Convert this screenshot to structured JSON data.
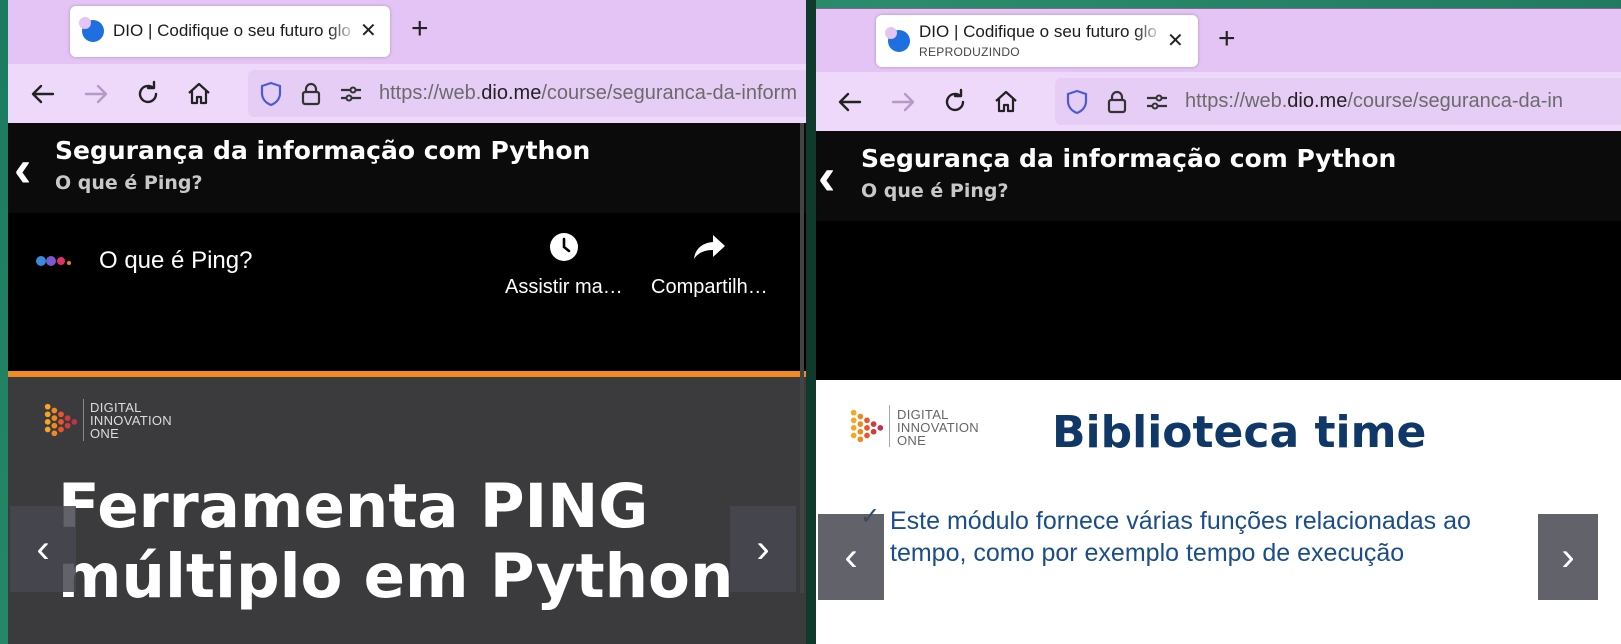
{
  "colors": {
    "tabbar": "#e3c4f5",
    "navbar": "#efd9fb",
    "accent_orange": "#f28a20",
    "slide_title_blue": "#0f3868",
    "slide_text_blue": "#1b4d8a",
    "dark_slide": "#3b3b3d"
  },
  "left_window": {
    "tab": {
      "title": "DIO | Codifique o seu futuro glo",
      "close": "✕"
    },
    "newtab": "+",
    "url": {
      "pre": "https://web.",
      "domain": "dio.me",
      "post": "/course/seguranca-da-inform"
    },
    "page": {
      "back": "‹",
      "title": "Segurança da informação com Python",
      "subtitle": "O que é Ping?"
    },
    "video": {
      "title": "O que é Ping?",
      "watch_later": "Assistir ma…",
      "share": "Compartilh…"
    },
    "slide": {
      "logo_line1": "DIGITAL",
      "logo_line2": "INNOVATION",
      "logo_line3": "ONE",
      "heading_line1": "Ferramenta PING",
      "heading_line2": "múltiplo em Python"
    },
    "prev": "‹",
    "next": "›"
  },
  "right_window": {
    "tab": {
      "title": "DIO | Codifique o seu futuro glo",
      "subtitle": "REPRODUZINDO",
      "close": "✕"
    },
    "newtab": "+",
    "url": {
      "pre": "https://web.",
      "domain": "dio.me",
      "post": "/course/seguranca-da-in"
    },
    "page": {
      "back": "‹",
      "title": "Segurança da informação com Python",
      "subtitle": "O que é Ping?"
    },
    "slide": {
      "logo_line1": "DIGITAL",
      "logo_line2": "INNOVATION",
      "logo_line3": "ONE",
      "heading": "Biblioteca time",
      "check": "✓",
      "body_line1": "Este módulo fornece várias funções relacionadas ao",
      "body_line2": "tempo, como por exemplo tempo de execução"
    },
    "prev": "‹",
    "next": "›"
  }
}
